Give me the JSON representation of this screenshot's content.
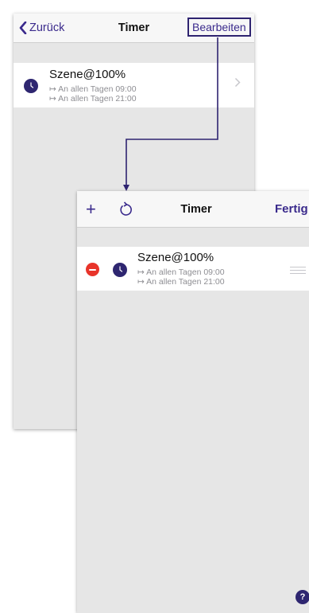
{
  "screen_before": {
    "nav": {
      "back_label": "Zurück",
      "title": "Timer",
      "edit_label": "Bearbeiten"
    },
    "timer_row": {
      "title": "Szene@100%",
      "schedule_1": "↦ An allen Tagen 09:00",
      "schedule_2": "↦ An allen Tagen 21:00"
    }
  },
  "screen_after": {
    "nav": {
      "title": "Timer",
      "done_label": "Fertig",
      "add_symbol": "+"
    },
    "timer_row": {
      "title": "Szene@100%",
      "schedule_1": "↦ An allen Tagen 09:00",
      "schedule_2": "↦ An allen Tagen 21:00"
    },
    "help_label": "?"
  },
  "colors": {
    "accent": "#3a2a8c",
    "clock": "#2e2670",
    "delete": "#e8342a",
    "background": "#e6e6e6"
  },
  "icons": [
    "back-chevron-icon",
    "clock-icon",
    "chevron-right-icon",
    "plus-icon",
    "refresh-icon",
    "delete-icon",
    "reorder-icon",
    "help-icon"
  ]
}
